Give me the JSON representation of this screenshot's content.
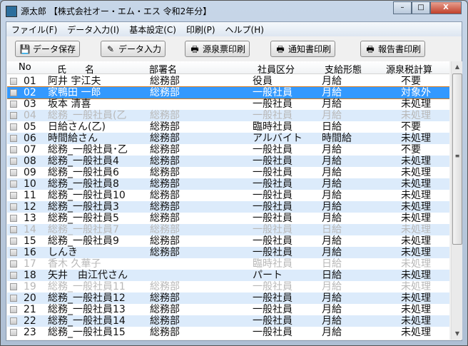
{
  "window": {
    "title": "源太郎 【株式会社オー・エム・エス 令和2年分】",
    "minimize": "–",
    "maximize": "□",
    "close": "X"
  },
  "menu": [
    "ファイル(F)",
    "データ入力(I)",
    "基本設定(C)",
    "印刷(P)",
    "ヘルプ(H)"
  ],
  "toolbar": [
    {
      "label": "データ保存",
      "icon": "save-icon",
      "glyph": "💾"
    },
    {
      "label": "データ入力",
      "icon": "data-entry-icon",
      "glyph": "✎"
    },
    {
      "label": "源泉票印刷",
      "icon": "printer-icon",
      "glyph": "🖶"
    },
    {
      "label": "通知書印刷",
      "icon": "printer-icon",
      "glyph": "🖶"
    },
    {
      "label": "報告書印刷",
      "icon": "printer-icon",
      "glyph": "🖶"
    }
  ],
  "columns": {
    "no": "No",
    "name": "氏　　名",
    "dept": "部署名",
    "class": "社員区分",
    "pay": "支給形態",
    "tax": "源泉税計算"
  },
  "rows": [
    {
      "no": "01",
      "name": "阿井 宇江夫",
      "dept": "総務部",
      "class": "役員",
      "pay": "月給",
      "tax": "不要"
    },
    {
      "no": "02",
      "name": "家鴨田 一郎",
      "dept": "総務部",
      "class": "一般社員",
      "pay": "月給",
      "tax": "対象外",
      "selected": true
    },
    {
      "no": "03",
      "name": "坂本 清喜",
      "dept": "",
      "class": "一般社員",
      "pay": "月給",
      "tax": "未処理"
    },
    {
      "no": "04",
      "name": "総務_一般社員(乙",
      "dept": "総務部",
      "class": "一般社員",
      "pay": "月給",
      "tax": "未処理",
      "disabled": true
    },
    {
      "no": "05",
      "name": "日給さん(乙)",
      "dept": "総務部",
      "class": "臨時社員",
      "pay": "日給",
      "tax": "不要"
    },
    {
      "no": "06",
      "name": "時間給さん",
      "dept": "総務部",
      "class": "アルバイト",
      "pay": "時間給",
      "tax": "未処理"
    },
    {
      "no": "07",
      "name": "総務_一般社員･乙",
      "dept": "総務部",
      "class": "一般社員",
      "pay": "月給",
      "tax": "不要"
    },
    {
      "no": "08",
      "name": "総務_一般社員4",
      "dept": "総務部",
      "class": "一般社員",
      "pay": "月給",
      "tax": "未処理"
    },
    {
      "no": "09",
      "name": "総務_一般社員6",
      "dept": "総務部",
      "class": "一般社員",
      "pay": "月給",
      "tax": "未処理"
    },
    {
      "no": "10",
      "name": "総務_一般社員8",
      "dept": "総務部",
      "class": "一般社員",
      "pay": "月給",
      "tax": "未処理"
    },
    {
      "no": "11",
      "name": "総務_一般社員10",
      "dept": "総務部",
      "class": "一般社員",
      "pay": "月給",
      "tax": "未処理"
    },
    {
      "no": "12",
      "name": "総務_一般社員3",
      "dept": "総務部",
      "class": "一般社員",
      "pay": "月給",
      "tax": "未処理"
    },
    {
      "no": "13",
      "name": "総務_一般社員5",
      "dept": "総務部",
      "class": "一般社員",
      "pay": "月給",
      "tax": "未処理"
    },
    {
      "no": "14",
      "name": "総務_一般社員7",
      "dept": "総務部",
      "class": "一般社員",
      "pay": "日給",
      "tax": "未処理",
      "disabled": true
    },
    {
      "no": "15",
      "name": "総務_一般社員9",
      "dept": "総務部",
      "class": "一般社員",
      "pay": "月給",
      "tax": "未処理"
    },
    {
      "no": "16",
      "name": "しんき",
      "dept": "総務部",
      "class": "一般社員",
      "pay": "月給",
      "tax": "未処理"
    },
    {
      "no": "17",
      "name": "香木 久華子",
      "dept": "",
      "class": "臨時社員",
      "pay": "日給",
      "tax": "未処理",
      "disabled": true
    },
    {
      "no": "18",
      "name": "矢井　由江代さん",
      "dept": "",
      "class": "パート",
      "pay": "日給",
      "tax": "未処理"
    },
    {
      "no": "19",
      "name": "総務_一般社員11",
      "dept": "総務部",
      "class": "一般社員",
      "pay": "月給",
      "tax": "未処理",
      "disabled": true
    },
    {
      "no": "20",
      "name": "総務_一般社員12",
      "dept": "総務部",
      "class": "一般社員",
      "pay": "月給",
      "tax": "未処理"
    },
    {
      "no": "21",
      "name": "総務_一般社員13",
      "dept": "総務部",
      "class": "一般社員",
      "pay": "月給",
      "tax": "未処理"
    },
    {
      "no": "22",
      "name": "総務_一般社員14",
      "dept": "総務部",
      "class": "一般社員",
      "pay": "月給",
      "tax": "未処理"
    },
    {
      "no": "23",
      "name": "総務_一般社員15",
      "dept": "総務部",
      "class": "一般社員",
      "pay": "月給",
      "tax": "未処理"
    }
  ]
}
